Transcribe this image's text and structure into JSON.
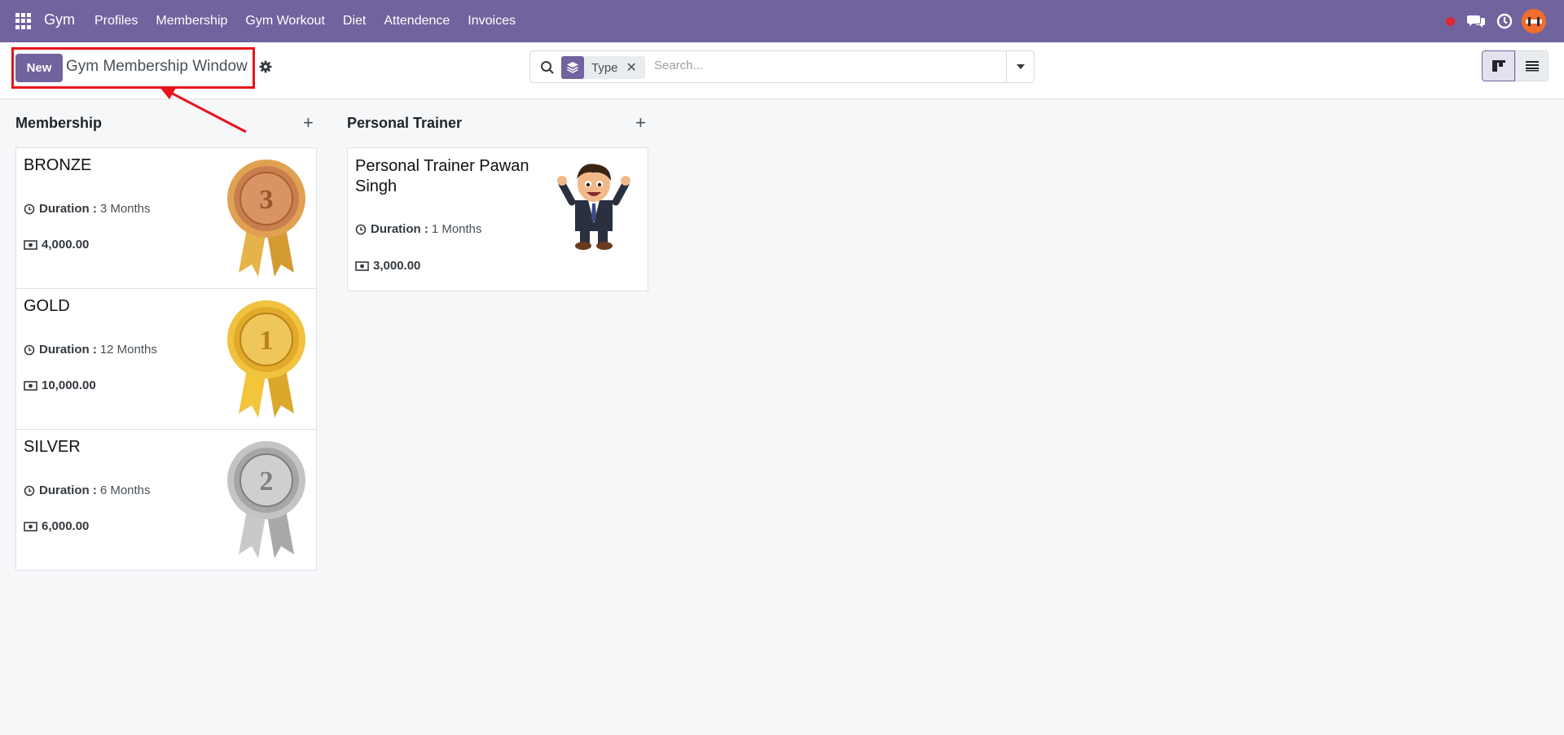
{
  "navbar": {
    "brand": "Gym",
    "menu": [
      "Profiles",
      "Membership",
      "Gym Workout",
      "Diet",
      "Attendence",
      "Invoices"
    ]
  },
  "control": {
    "new_label": "New",
    "title": "Gym Membership Window"
  },
  "search": {
    "facet_label": "Type",
    "placeholder": "Search..."
  },
  "columns": [
    {
      "title": "Membership",
      "cards": [
        {
          "name": "BRONZE",
          "duration_label": "Duration :",
          "duration": "3 Months",
          "price": "4,000.00",
          "medal": "bronze",
          "medal_number": "3"
        },
        {
          "name": "GOLD",
          "duration_label": "Duration :",
          "duration": "12 Months",
          "price": "10,000.00",
          "medal": "gold",
          "medal_number": "1"
        },
        {
          "name": "SILVER",
          "duration_label": "Duration :",
          "duration": "6 Months",
          "price": "6,000.00",
          "medal": "silver",
          "medal_number": "2"
        }
      ]
    },
    {
      "title": "Personal Trainer",
      "cards": [
        {
          "name_line1": "Personal Trainer Pawan",
          "name_line2": "Singh",
          "duration_label": "Duration :",
          "duration": "1 Months",
          "price": "3,000.00"
        }
      ]
    }
  ],
  "colors": {
    "brand": "#71639e",
    "annotation": "#e8141b",
    "bronze": "#c87f4e",
    "gold": "#e6b22e",
    "silver": "#b7b7b7"
  }
}
